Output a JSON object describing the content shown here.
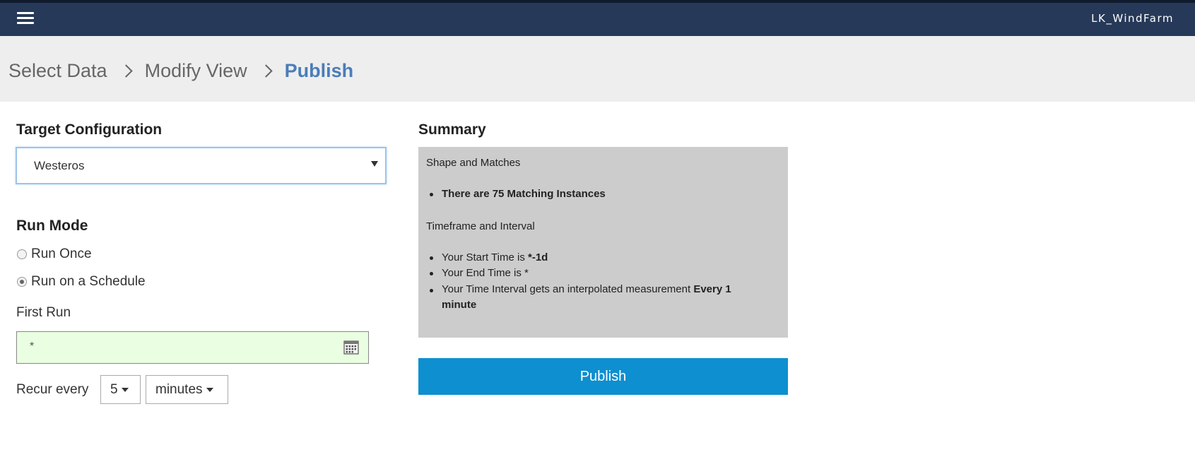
{
  "header": {
    "app_name": "LK_WindFarm"
  },
  "breadcrumb": {
    "items": [
      "Select Data",
      "Modify View",
      "Publish"
    ],
    "active_index": 2
  },
  "target": {
    "title": "Target Configuration",
    "selected": "Westeros"
  },
  "run_mode": {
    "title": "Run Mode",
    "options": [
      "Run Once",
      "Run on a Schedule"
    ],
    "selected": "Run on a Schedule",
    "first_run_label": "First Run",
    "first_run_value": "*",
    "recur_label": "Recur every",
    "recur_value": "5",
    "recur_unit": "minutes"
  },
  "summary": {
    "title": "Summary",
    "shape_heading": "Shape and Matches",
    "shape_bullet": "There are 75 Matching Instances",
    "time_heading": "Timeframe and Interval",
    "start_prefix": "Your Start Time is ",
    "start_value": "*-1d",
    "end_prefix": "Your End Time is ",
    "end_value": "*",
    "interval_prefix": "Your Time Interval gets an interpolated measurement ",
    "interval_value_line1": "Every 1",
    "interval_value_line2": "minute"
  },
  "actions": {
    "publish_label": "Publish"
  },
  "colors": {
    "topbar": "#263958",
    "active_crumb": "#4a7db8",
    "publish": "#0d8fd0",
    "summary_bg": "#cccccc"
  }
}
